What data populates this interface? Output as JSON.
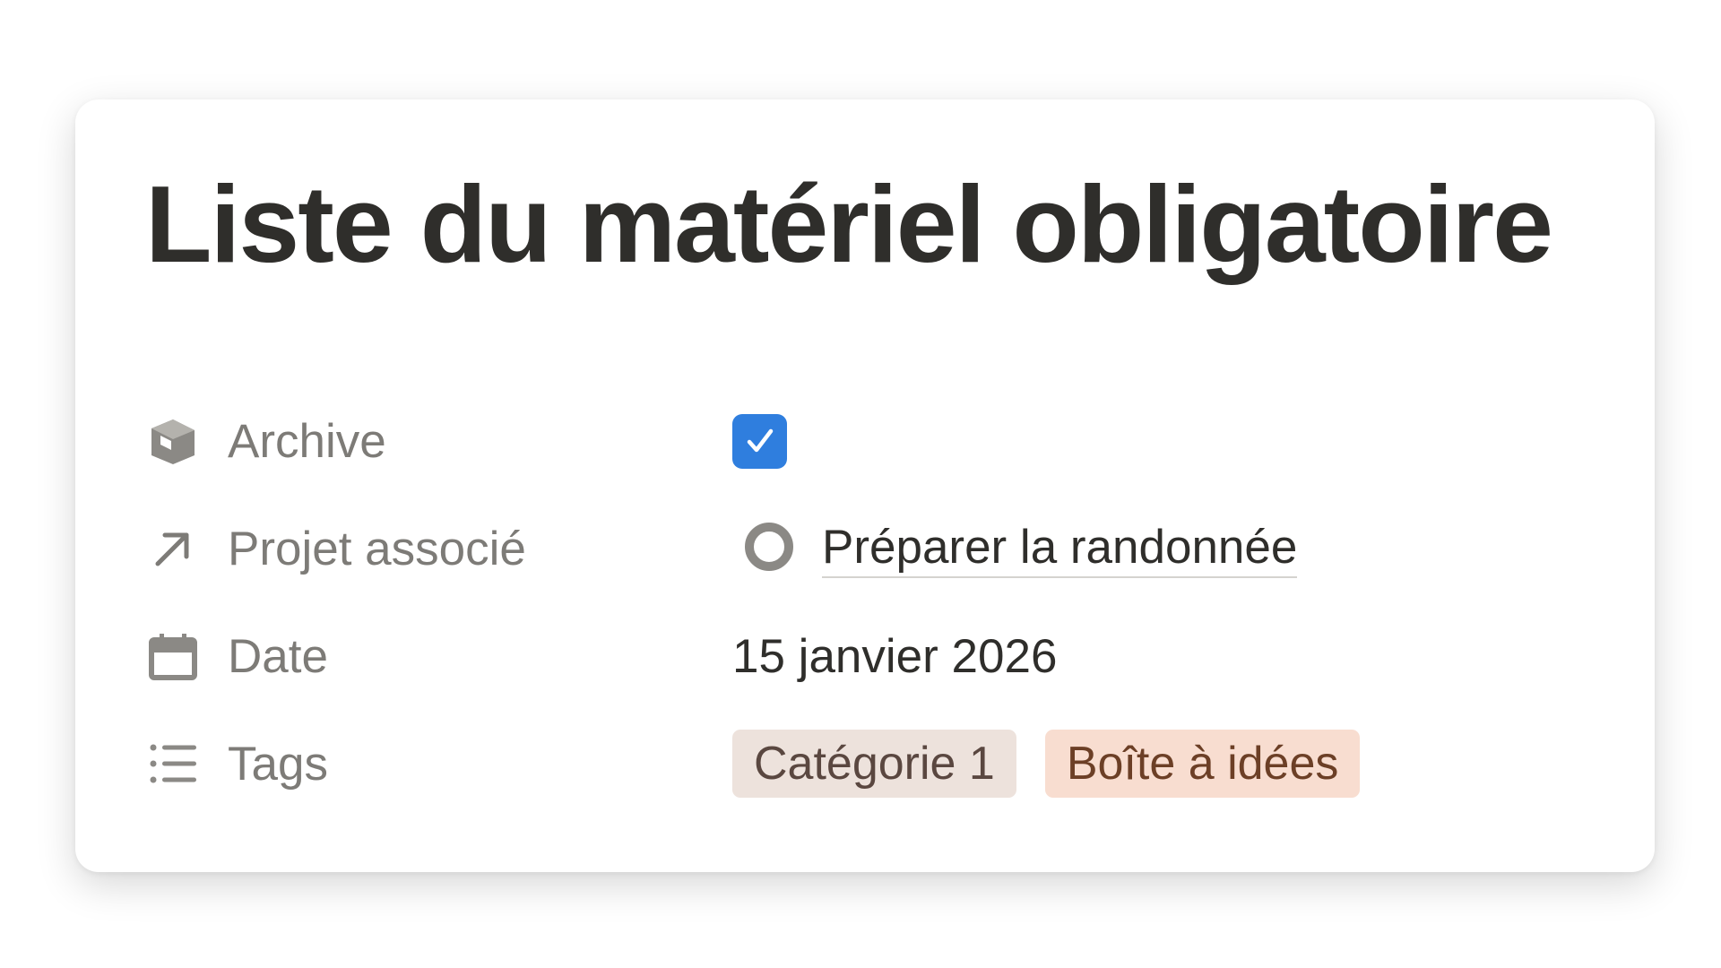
{
  "page": {
    "title": "Liste du matériel obligatoire"
  },
  "properties": [
    {
      "icon": "archive-box-icon",
      "label": "Archive",
      "type": "checkbox",
      "checked": true
    },
    {
      "icon": "arrow-up-right-icon",
      "label": "Projet associé",
      "type": "relation",
      "value": "Préparer la randonnée",
      "value_icon": "circle-status-icon"
    },
    {
      "icon": "calendar-icon",
      "label": "Date",
      "type": "date",
      "value": "15 janvier 2026"
    },
    {
      "icon": "list-icon",
      "label": "Tags",
      "type": "multi_select",
      "tags": [
        {
          "label": "Catégorie 1",
          "color": "#ede2dc"
        },
        {
          "label": "Boîte à idées",
          "color": "#f8ddd0"
        }
      ]
    }
  ],
  "colors": {
    "checkbox_accent": "#2f7ede",
    "text_primary": "#2f2e2b",
    "text_secondary": "#7d7b77"
  }
}
